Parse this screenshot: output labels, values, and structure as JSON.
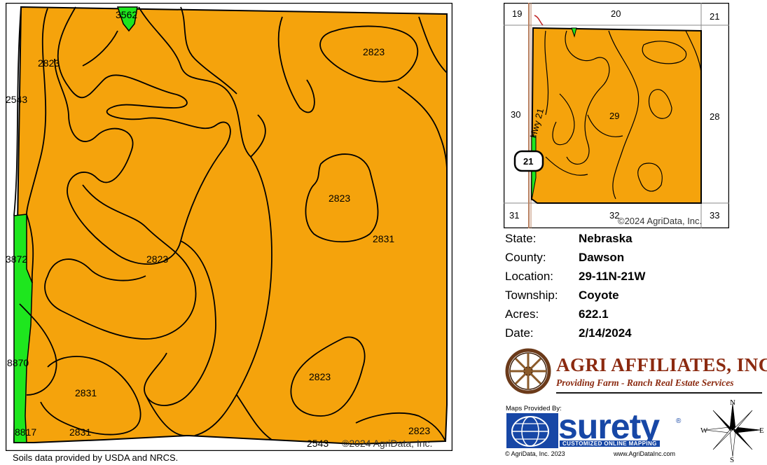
{
  "main_map": {
    "soil_labels": [
      {
        "text": "3562"
      },
      {
        "text": "2823"
      },
      {
        "text": "2823"
      },
      {
        "text": "2543"
      },
      {
        "text": "2823"
      },
      {
        "text": "2831"
      },
      {
        "text": "3872"
      },
      {
        "text": "2823"
      },
      {
        "text": "8870"
      },
      {
        "text": "2823"
      },
      {
        "text": "2831"
      },
      {
        "text": "8817"
      },
      {
        "text": "2831"
      },
      {
        "text": "2543"
      },
      {
        "text": "2823"
      }
    ],
    "copyright": "©2024 AgriData, Inc.",
    "colors": {
      "orange": "#f5a30c",
      "green": "#1ee61e",
      "line": "#000000"
    }
  },
  "footer_note": "Soils data provided by USDA and NRCS.",
  "inset_map": {
    "section_numbers": [
      "19",
      "20",
      "21",
      "30",
      "29",
      "28",
      "31",
      "32",
      "33"
    ],
    "highway_label": "Hwy 21",
    "shield_number": "21",
    "copyright": "©2024 AgriData, Inc."
  },
  "info": [
    {
      "key": "State:",
      "value": "Nebraska"
    },
    {
      "key": "County:",
      "value": "Dawson"
    },
    {
      "key": "Location:",
      "value": "29-11N-21W"
    },
    {
      "key": "Township:",
      "value": "Coyote"
    },
    {
      "key": "Acres:",
      "value": "622.1"
    },
    {
      "key": "Date:",
      "value": "2/14/2024"
    }
  ],
  "logo": {
    "name": "AGRI AFFILIATES, INC.",
    "tagline": "Providing Farm - Ranch Real Estate Services"
  },
  "provider": {
    "label": "Maps Provided By:",
    "brand": "surety",
    "reg_mark": "®",
    "subtitle": "CUSTOMIZED ONLINE MAPPING",
    "copyright": "© AgriData, Inc. 2023",
    "url": "www.AgriDataInc.com"
  },
  "compass": {
    "n": "N",
    "s": "S",
    "e": "E",
    "w": "W"
  }
}
